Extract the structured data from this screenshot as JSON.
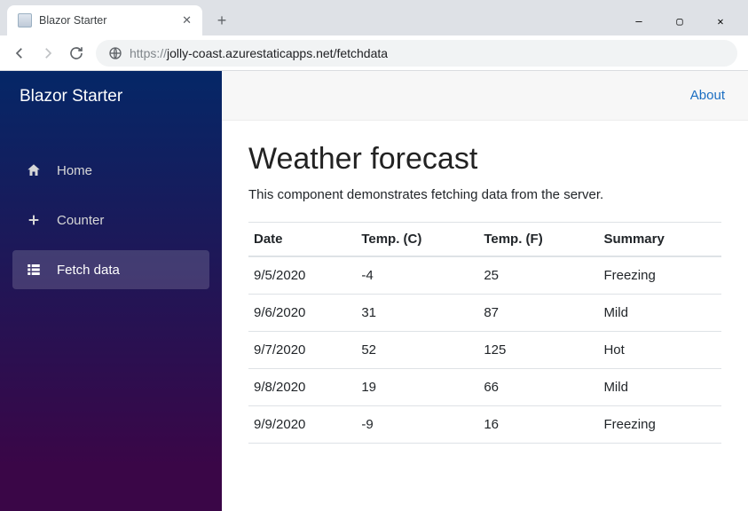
{
  "browser": {
    "tab_title": "Blazor Starter",
    "url_scheme": "https://",
    "url_rest": "jolly-coast.azurestaticapps.net/fetchdata"
  },
  "sidebar": {
    "brand": "Blazor Starter",
    "items": [
      {
        "label": "Home"
      },
      {
        "label": "Counter"
      },
      {
        "label": "Fetch data"
      }
    ],
    "active_index": 2
  },
  "topbar": {
    "about": "About"
  },
  "page": {
    "title": "Weather forecast",
    "lead": "This component demonstrates fetching data from the server."
  },
  "table": {
    "headers": [
      "Date",
      "Temp. (C)",
      "Temp. (F)",
      "Summary"
    ],
    "rows": [
      {
        "date": "9/5/2020",
        "tc": "-4",
        "tf": "25",
        "summary": "Freezing"
      },
      {
        "date": "9/6/2020",
        "tc": "31",
        "tf": "87",
        "summary": "Mild"
      },
      {
        "date": "9/7/2020",
        "tc": "52",
        "tf": "125",
        "summary": "Hot"
      },
      {
        "date": "9/8/2020",
        "tc": "19",
        "tf": "66",
        "summary": "Mild"
      },
      {
        "date": "9/9/2020",
        "tc": "-9",
        "tf": "16",
        "summary": "Freezing"
      }
    ]
  }
}
